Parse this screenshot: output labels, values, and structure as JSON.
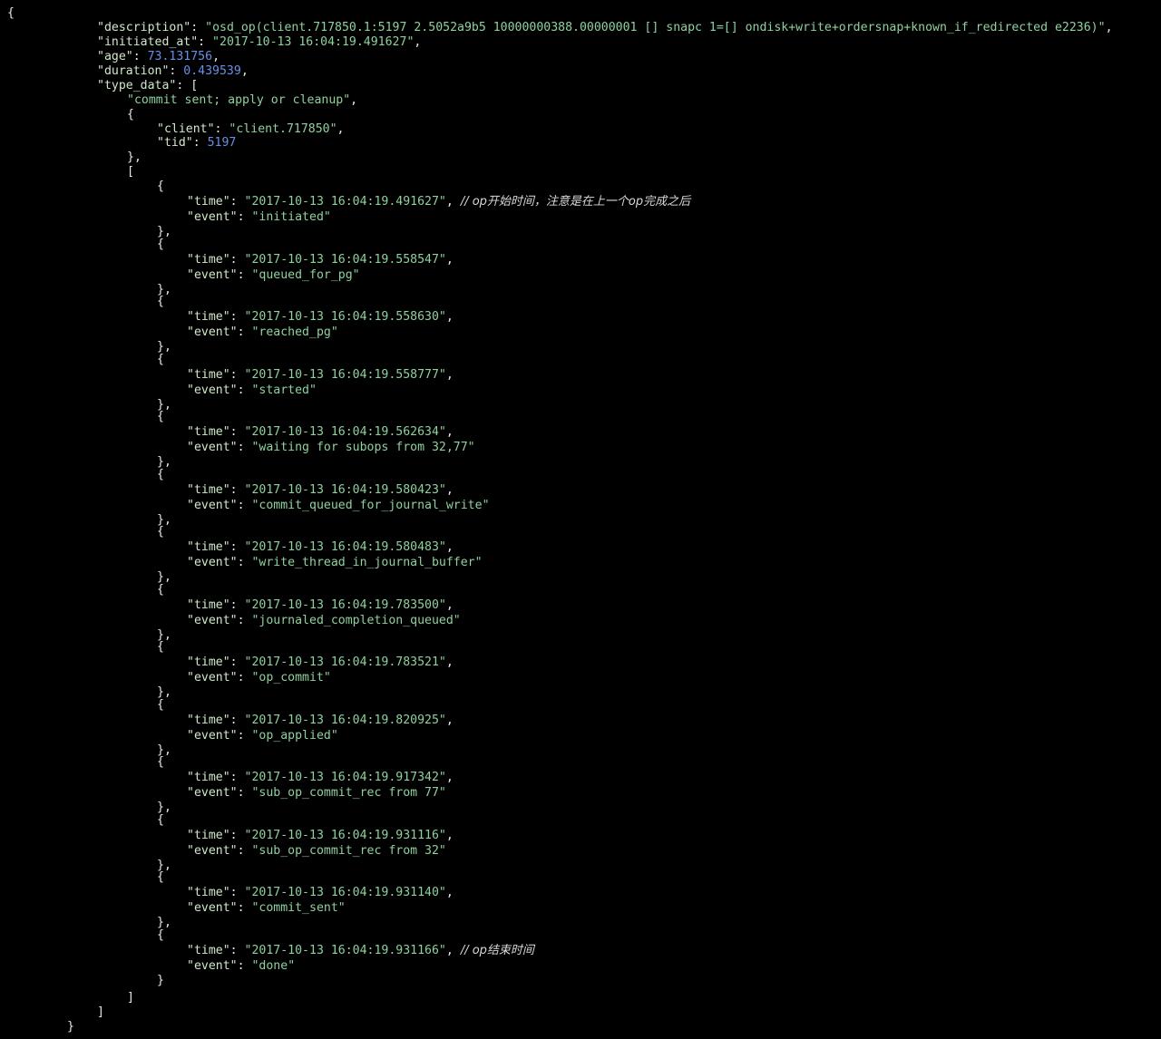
{
  "colors": {
    "background": "#000000",
    "key": "#cfe8c8",
    "string": "#8fd19e",
    "number": "#6b8fe8",
    "punctuation": "#e8e8e8",
    "comment": "#d8d8d8"
  },
  "op": {
    "description": "osd_op(client.717850.1:5197 2.5052a9b5 10000000388.00000001 [] snapc 1=[] ondisk+write+ordersnap+known_if_redirected e2236)",
    "initiated_at": "2017-10-13 16:04:19.491627",
    "age": "73.131756",
    "duration": "0.439539",
    "type_data_label": "commit sent; apply or cleanup",
    "client": "client.717850",
    "tid": "5197",
    "events": [
      {
        "time": "2017-10-13 16:04:19.491627",
        "event": "initiated",
        "comment": "// op开始时间，注意是在上一个op完成之后"
      },
      {
        "time": "2017-10-13 16:04:19.558547",
        "event": "queued_for_pg"
      },
      {
        "time": "2017-10-13 16:04:19.558630",
        "event": "reached_pg"
      },
      {
        "time": "2017-10-13 16:04:19.558777",
        "event": "started"
      },
      {
        "time": "2017-10-13 16:04:19.562634",
        "event": "waiting for subops from 32,77"
      },
      {
        "time": "2017-10-13 16:04:19.580423",
        "event": "commit_queued_for_journal_write"
      },
      {
        "time": "2017-10-13 16:04:19.580483",
        "event": "write_thread_in_journal_buffer"
      },
      {
        "time": "2017-10-13 16:04:19.783500",
        "event": "journaled_completion_queued"
      },
      {
        "time": "2017-10-13 16:04:19.783521",
        "event": "op_commit"
      },
      {
        "time": "2017-10-13 16:04:19.820925",
        "event": "op_applied"
      },
      {
        "time": "2017-10-13 16:04:19.917342",
        "event": "sub_op_commit_rec from 77"
      },
      {
        "time": "2017-10-13 16:04:19.931116",
        "event": "sub_op_commit_rec from 32"
      },
      {
        "time": "2017-10-13 16:04:19.931140",
        "event": "commit_sent"
      },
      {
        "time": "2017-10-13 16:04:19.931166",
        "event": "done",
        "comment": "// op结束时间"
      }
    ]
  }
}
